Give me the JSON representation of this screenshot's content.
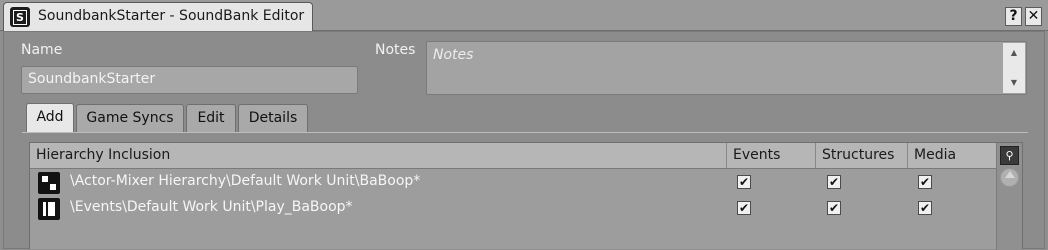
{
  "window": {
    "tab_title": "SoundbankStarter - SoundBank Editor",
    "app_icon_letter": "S",
    "help_label": "?",
    "close_label": "✕"
  },
  "form": {
    "name_label": "Name",
    "name_value": "SoundbankStarter",
    "notes_label": "Notes",
    "notes_placeholder": "Notes"
  },
  "tabs": [
    {
      "label": "Add",
      "active": true
    },
    {
      "label": "Game Syncs",
      "active": false
    },
    {
      "label": "Edit",
      "active": false
    },
    {
      "label": "Details",
      "active": false
    }
  ],
  "table": {
    "columns": [
      "Hierarchy Inclusion",
      "Events",
      "Structures",
      "Media"
    ],
    "rows": [
      {
        "icon": "actor-mixer-workunit-icon",
        "path": "\\Actor-Mixer Hierarchy\\Default Work Unit\\BaBoop*",
        "events": true,
        "structures": true,
        "media": true
      },
      {
        "icon": "events-workunit-icon",
        "path": "\\Events\\Default Work Unit\\Play_BaBoop*",
        "events": true,
        "structures": true,
        "media": true
      }
    ]
  },
  "check_glyph": "✔",
  "colors": {
    "panel": "#8c8c8c",
    "tab_active": "#e8e8e8",
    "header": "#b6b6b6"
  }
}
